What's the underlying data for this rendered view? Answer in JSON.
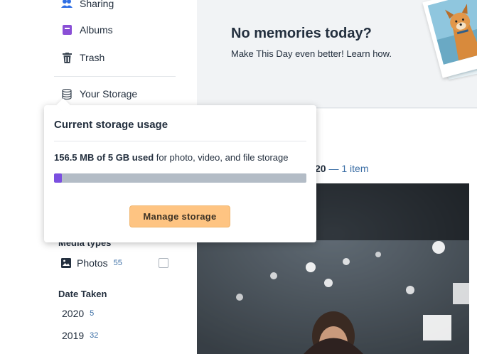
{
  "sidebar": {
    "items": [
      {
        "label": "Sharing",
        "icon": "people-icon"
      },
      {
        "label": "Albums",
        "icon": "album-icon"
      },
      {
        "label": "Trash",
        "icon": "trash-icon"
      },
      {
        "label": "Your Storage",
        "icon": "database-icon"
      }
    ],
    "filters": {
      "media_types": {
        "heading": "Media types",
        "items": [
          {
            "label": "Photos",
            "count": "55",
            "checked": false
          }
        ]
      },
      "date_taken": {
        "heading": "Date Taken",
        "items": [
          {
            "label": "2020",
            "count": "5"
          },
          {
            "label": "2019",
            "count": "32"
          }
        ]
      }
    }
  },
  "memories": {
    "title": "No memories today?",
    "subtitle_prefix": "Make This Day even better! ",
    "subtitle_link": "Learn how."
  },
  "feed": {
    "date_fragment": "20",
    "separator": " — ",
    "item_count": "1 item",
    "dot_fragment": "."
  },
  "storage_popover": {
    "title": "Current storage usage",
    "usage_bold": "156.5 MB of 5 GB used",
    "usage_rest": " for photo, video, and file storage",
    "usage_fraction": 0.031,
    "button_label": "Manage storage"
  },
  "colors": {
    "accent_purple": "#7b4fe0",
    "button_orange": "#fec482",
    "link_blue": "#3b6ea5",
    "text_dark": "#232f3e"
  }
}
